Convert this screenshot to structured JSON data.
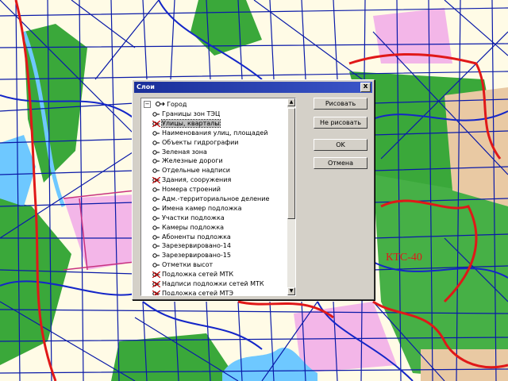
{
  "dialog": {
    "title": "Слои",
    "close_label": "x",
    "buttons": {
      "draw": "Рисовать",
      "no_draw": "Не рисовать",
      "ok": "OK",
      "cancel": "Отмена"
    },
    "tree": {
      "root_toggle": "−",
      "root": "Город",
      "items": [
        {
          "label": "Границы зон ТЭЦ",
          "visible": true
        },
        {
          "label": "Улицы, кварталы",
          "visible": false,
          "selected": true
        },
        {
          "label": "Наименования улиц, площадей",
          "visible": true
        },
        {
          "label": "Объекты гидрографии",
          "visible": true
        },
        {
          "label": "Зеленая зона",
          "visible": true
        },
        {
          "label": "Железные дороги",
          "visible": true
        },
        {
          "label": "Отдельные надписи",
          "visible": true
        },
        {
          "label": "Здания, сооружения",
          "visible": false
        },
        {
          "label": "Номера строений",
          "visible": true
        },
        {
          "label": "Адм.-территориальное деление",
          "visible": true
        },
        {
          "label": "Имена камер подложка",
          "visible": true
        },
        {
          "label": "Участки подложка",
          "visible": true
        },
        {
          "label": "Камеры подложка",
          "visible": true
        },
        {
          "label": "Абоненты подложка",
          "visible": true
        },
        {
          "label": "Зарезервировано-14",
          "visible": true
        },
        {
          "label": "Зарезервировано-15",
          "visible": true
        },
        {
          "label": "Отметки высот",
          "visible": true
        },
        {
          "label": "Подложка сетей МТК",
          "visible": false
        },
        {
          "label": "Надписи подложки сетей МТК",
          "visible": false
        },
        {
          "label": "Подложка сетей МТЭ",
          "visible": false
        }
      ]
    }
  },
  "map": {
    "labels": {
      "district_label": "КТС-40"
    },
    "colors": {
      "background": "#fffbe6",
      "network": "#0a1aa8",
      "boundary": "#e01818",
      "green": "#3aa83a",
      "water": "#6ec8ff",
      "pink": "#f3b6e8",
      "tan": "#e9c9a3"
    }
  }
}
